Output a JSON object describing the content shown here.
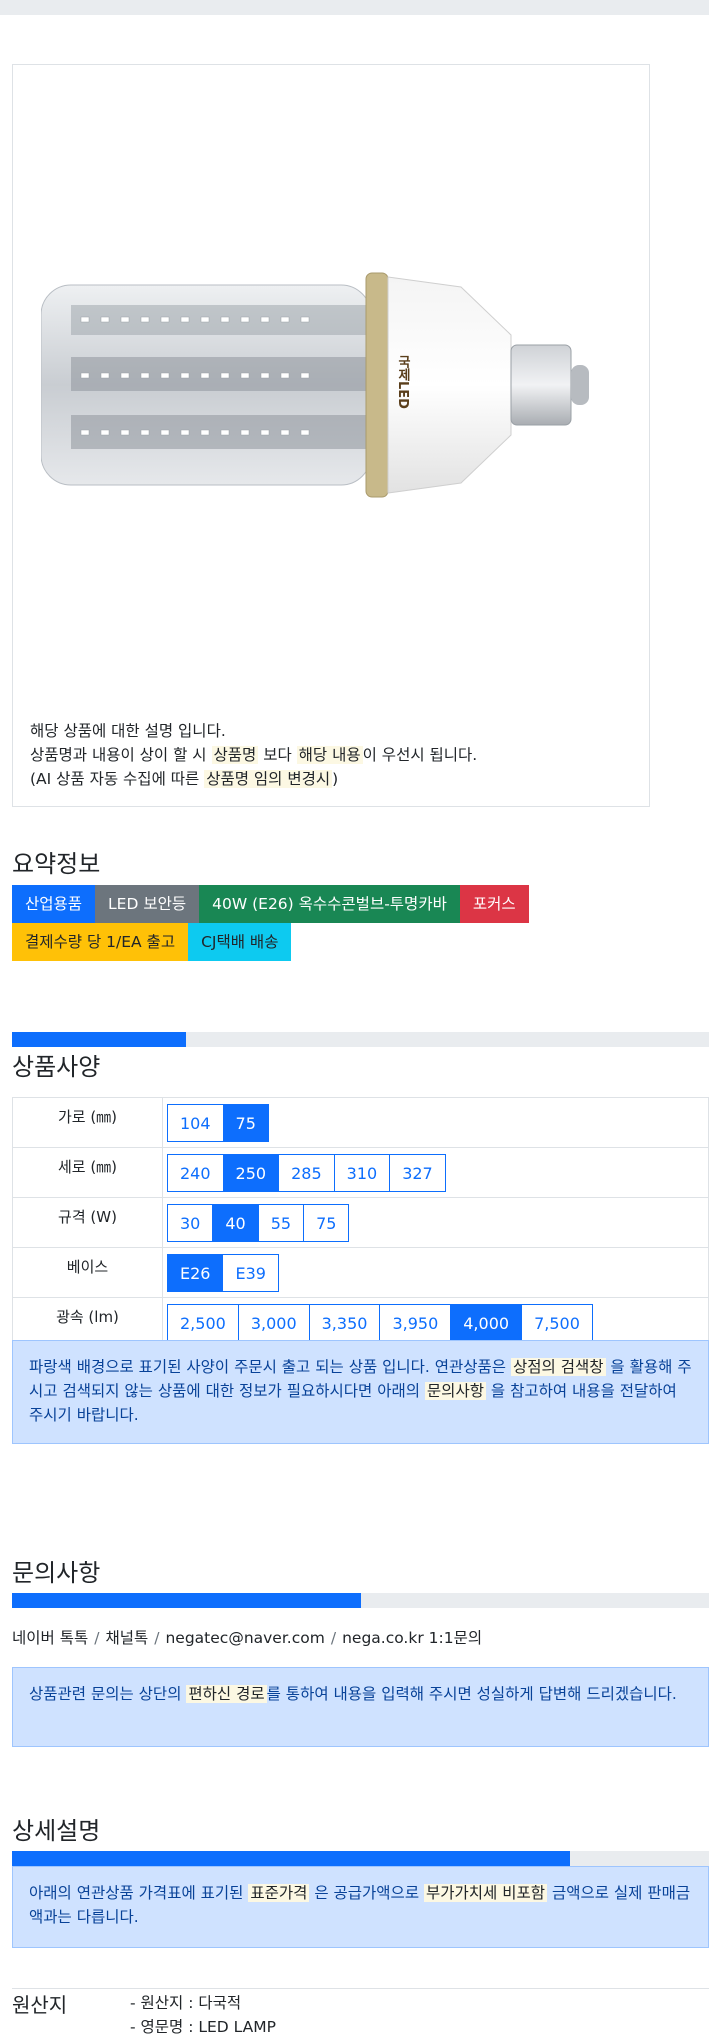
{
  "product": {
    "description_lines": [
      {
        "parts": [
          "해당 상품에 대한 설명 입니다."
        ]
      },
      {
        "parts": [
          "상품명과 내용이 상이 할 시 ",
          "상품명",
          " 보다 ",
          "해당 내용",
          "이 우선시 됩니다."
        ]
      },
      {
        "parts": [
          "(AI 상품 자동 수집에 따른 ",
          "상품명 임의 변경시",
          ")"
        ]
      }
    ],
    "lamp_label": "국제LED"
  },
  "summary": {
    "title": "요약정보",
    "badges_row1": [
      "산업용품",
      "LED 보안등",
      "40W (E26) 옥수수콘벌브-투명카바",
      "포커스"
    ],
    "badges_row2": [
      "결제수량 당 1/EA 출고",
      "CJ택배 배송"
    ]
  },
  "specs": {
    "progress_fraction": 0.25,
    "title": "상품사양",
    "rows": [
      {
        "label": "가로 (㎜)",
        "options": [
          "104",
          "75"
        ],
        "selected": "75"
      },
      {
        "label": "세로 (㎜)",
        "options": [
          "240",
          "250",
          "285",
          "310",
          "327"
        ],
        "selected": "250"
      },
      {
        "label": "규격 (W)",
        "options": [
          "30",
          "40",
          "55",
          "75"
        ],
        "selected": "40"
      },
      {
        "label": "베이스",
        "options": [
          "E26",
          "E39"
        ],
        "selected": "E26"
      },
      {
        "label": "광속 (lm)",
        "options": [
          "2,500",
          "3,000",
          "3,350",
          "3,950",
          "4,000",
          "7,500"
        ],
        "selected": "4,000"
      }
    ],
    "notice": {
      "a": "파랑색 배경으로 표기된 사양이 주문시 출고 되는 상품 입니다. 연관상품은 ",
      "m1": "상점의 검색창",
      "b": " 을 활용해 주시고 검색되지 않는 상품에 대한 정보가 필요하시다면 아래의 ",
      "m2": "문의사항",
      "c": " 을 참고하여 내용을 전달하여 주시기 바랍니다."
    }
  },
  "inquiry": {
    "title": "문의사항",
    "progress_fraction": 0.5,
    "links": [
      "네이버 톡톡",
      "채널톡",
      "negatec@naver.com",
      "nega.co.kr 1:1문의"
    ],
    "separator": "/",
    "notice": {
      "a": "상품관련 문의는 상단의 ",
      "m1": "편하신 경로",
      "b": "를 통하여 내용을 입력해 주시면 성실하게 답변해 드리겠습니다."
    }
  },
  "detail": {
    "title": "상세설명",
    "progress_fraction": 0.8,
    "notice": {
      "a": "아래의 연관상품 가격표에 표기된 ",
      "m1": "표준가격",
      "b": " 은 공급가액으로 ",
      "m2": "부가가치세 비포함",
      "c": " 금액으로 실제 판매금액과는 다릅니다."
    }
  },
  "origin": {
    "label": "원산지",
    "items": [
      "- 원산지 : 다국적",
      "- 영문명 : LED LAMP"
    ]
  },
  "colors": {
    "primary": "#0d6efd",
    "alert_bg": "#cfe2ff",
    "mark": "#fcf8e3"
  }
}
